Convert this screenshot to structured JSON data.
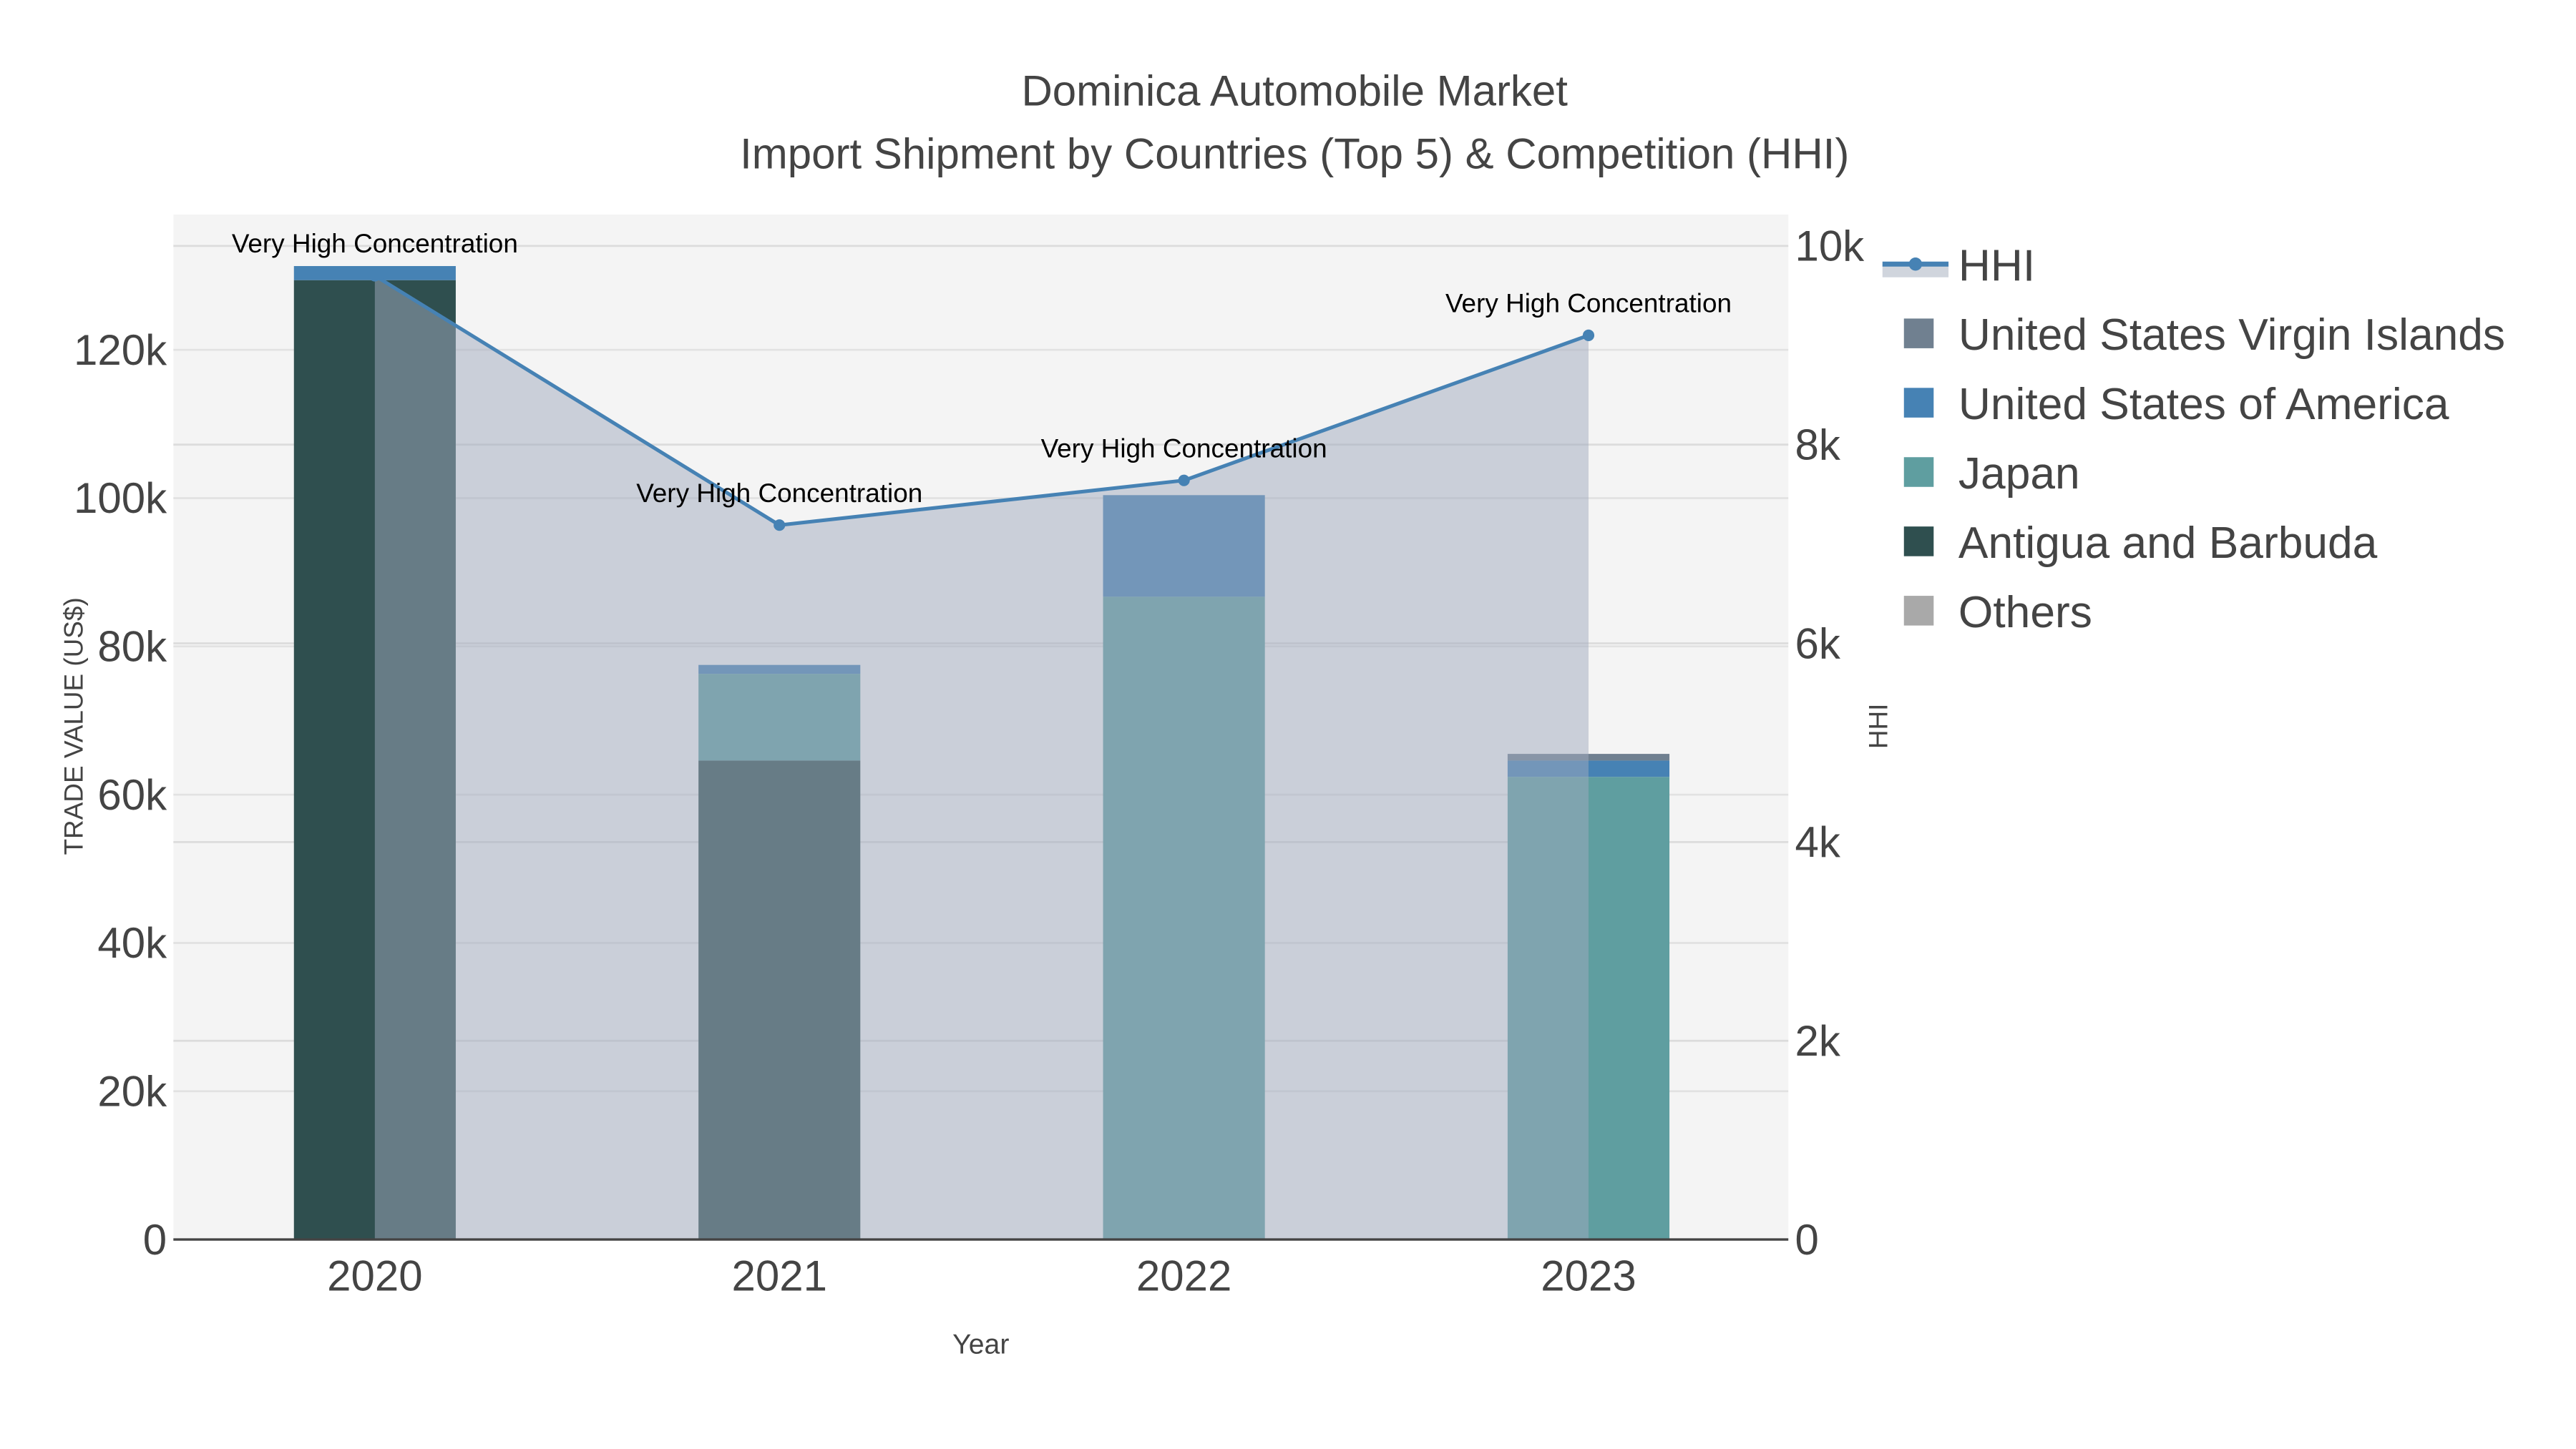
{
  "chart_data": {
    "type": "bar",
    "title": "Dominica Automobile Market",
    "subtitle": "Import Shipment by Countries (Top 5) & Competition (HHI)",
    "xlabel": "Year",
    "ylabel": "TRADE VALUE (US$)",
    "y2label": "HHI",
    "categories": [
      "2020",
      "2021",
      "2022",
      "2023"
    ],
    "ylim": [
      0,
      138000
    ],
    "y2lim": [
      0,
      10300
    ],
    "yticks": [
      0,
      20000,
      40000,
      60000,
      80000,
      100000,
      120000
    ],
    "ytick_labels": [
      "0",
      "20k",
      "40k",
      "60k",
      "80k",
      "100k",
      "120k"
    ],
    "y2ticks": [
      0,
      2000,
      4000,
      6000,
      8000,
      10000
    ],
    "y2tick_labels": [
      "0",
      "2k",
      "4k",
      "6k",
      "8k",
      "10k"
    ],
    "grid": true,
    "legend_placement": "right",
    "series": [
      {
        "name": "Antigua and Barbuda",
        "color": "#2f4f4f",
        "values": [
          129400,
          64600,
          0,
          0
        ]
      },
      {
        "name": "Japan",
        "color": "#5f9ea0",
        "values": [
          0,
          11700,
          86700,
          62400
        ]
      },
      {
        "name": "United States of America",
        "color": "#4682b4",
        "values": [
          1900,
          1200,
          13700,
          2200
        ]
      },
      {
        "name": "United States Virgin Islands",
        "color": "#708090",
        "values": [
          0,
          0,
          0,
          900
        ]
      },
      {
        "name": "Others",
        "color": "#a9a9a9",
        "values": [
          0,
          0,
          0,
          0
        ]
      }
    ],
    "hhi": {
      "name": "HHI",
      "color": "#4682b4",
      "values": [
        9700,
        7190,
        7640,
        9100
      ],
      "annotations": [
        "Very High Concentration",
        "Very High Concentration",
        "Very High Concentration",
        "Very High Concentration"
      ]
    },
    "legend_order": [
      "HHI",
      "United States Virgin Islands",
      "United States of America",
      "Japan",
      "Antigua and Barbuda",
      "Others"
    ]
  }
}
